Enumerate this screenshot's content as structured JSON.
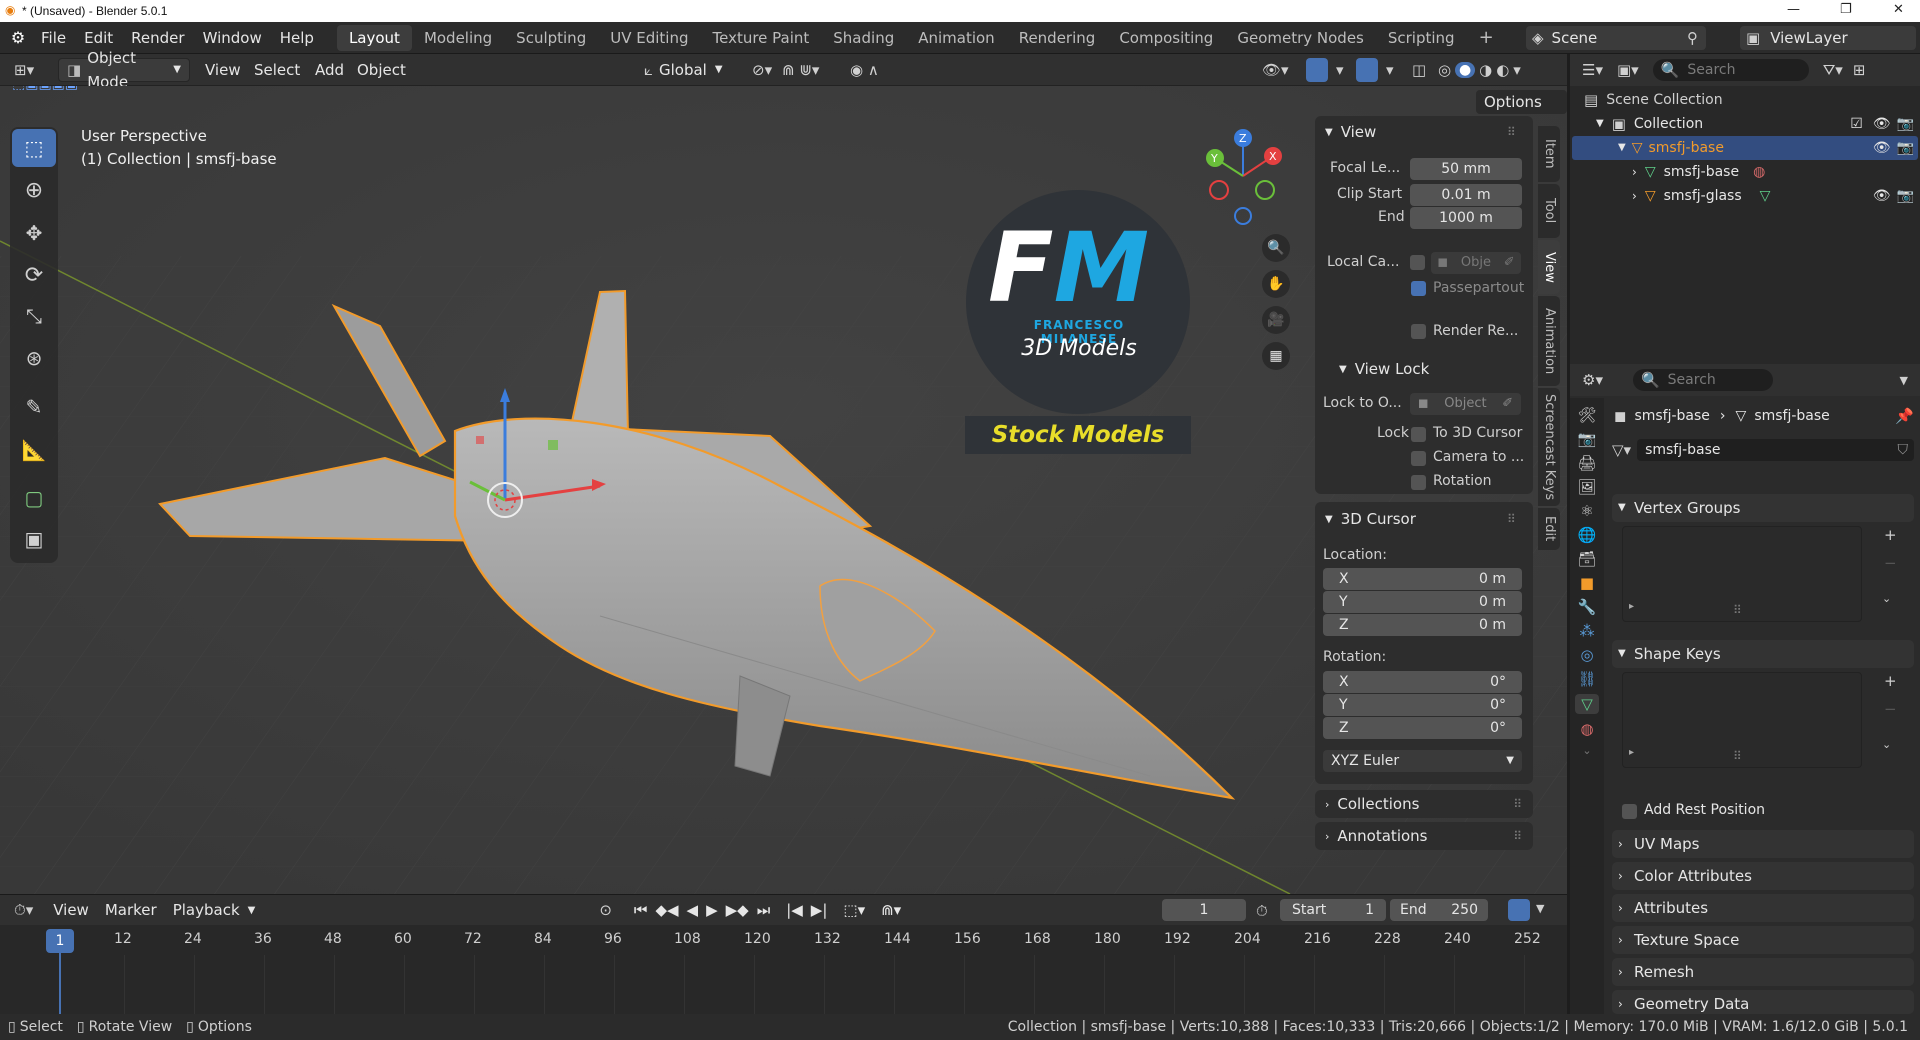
{
  "window": {
    "title": "* (Unsaved) - Blender 5.0.1"
  },
  "menu": {
    "items": [
      "File",
      "Edit",
      "Render",
      "Window",
      "Help"
    ]
  },
  "workspaces": [
    "Layout",
    "Modeling",
    "Sculpting",
    "UV Editing",
    "Texture Paint",
    "Shading",
    "Animation",
    "Rendering",
    "Compositing",
    "Geometry Nodes",
    "Scripting"
  ],
  "active_workspace": "Layout",
  "scene": {
    "label": "Scene",
    "view_layer": "ViewLayer"
  },
  "header": {
    "mode": "Object Mode",
    "items": [
      "View",
      "Select",
      "Add",
      "Object"
    ],
    "orientation": "Global",
    "options": "Options"
  },
  "viewport": {
    "perspective": "User Perspective",
    "context": "(1) Collection | smsfj-base"
  },
  "logo": {
    "initials_f": "F",
    "initials_m": "M",
    "name": "FRANCESCO MILANESE",
    "models": "3D Models",
    "stock": "Stock Models"
  },
  "npanel": {
    "tabs": [
      "Item",
      "Tool",
      "View",
      "Animation",
      "Screencast Keys",
      "Edit"
    ],
    "active_tab": "View",
    "view": {
      "title": "View",
      "focal_label": "Focal Le...",
      "focal_value": "50 mm",
      "clip_start_label": "Clip Start",
      "clip_start_value": "0.01 m",
      "end_label": "End",
      "end_value": "1000 m",
      "local_camera_label": "Local Ca...",
      "local_camera_value": "Obje",
      "passepartout": "Passepartout",
      "render_region": "Render Re..."
    },
    "view_lock": {
      "title": "View Lock",
      "lock_to_label": "Lock to O...",
      "lock_to_value": "Object",
      "lock_label": "Lock",
      "to_cursor": "To 3D Cursor",
      "camera_to": "Camera to ...",
      "rotation": "Rotation"
    },
    "cursor": {
      "title": "3D Cursor",
      "location_label": "Location:",
      "location": [
        {
          "axis": "X",
          "value": "0 m"
        },
        {
          "axis": "Y",
          "value": "0 m"
        },
        {
          "axis": "Z",
          "value": "0 m"
        }
      ],
      "rotation_label": "Rotation:",
      "rotation": [
        {
          "axis": "X",
          "value": "0°"
        },
        {
          "axis": "Y",
          "value": "0°"
        },
        {
          "axis": "Z",
          "value": "0°"
        }
      ],
      "rotation_mode": "XYZ Euler"
    },
    "collections": "Collections",
    "annotations": "Annotations"
  },
  "outliner": {
    "search_placeholder": "Search",
    "scene_collection": "Scene Collection",
    "collection": "Collection",
    "selected": "smsfj-base",
    "children": [
      "smsfj-base",
      "smsfj-glass"
    ]
  },
  "properties": {
    "search_placeholder": "Search",
    "breadcrumb_object": "smsfj-base",
    "breadcrumb_data": "smsfj-base",
    "mesh_name": "smsfj-base",
    "sections": [
      "Vertex Groups",
      "Shape Keys",
      "UV Maps",
      "Color Attributes",
      "Attributes",
      "Texture Space",
      "Remesh",
      "Geometry Data"
    ],
    "add_rest_position": "Add Rest Position"
  },
  "timeline": {
    "menu": [
      "View",
      "Marker",
      "Playback"
    ],
    "current_frame": "1",
    "start_label": "Start",
    "start": "1",
    "end_label": "End",
    "end": "250",
    "ticks": [
      "1",
      "12",
      "24",
      "36",
      "48",
      "60",
      "72",
      "84",
      "96",
      "108",
      "120",
      "132",
      "144",
      "156",
      "168",
      "180",
      "192",
      "204",
      "216",
      "228",
      "240",
      "252"
    ]
  },
  "status": {
    "select": "Select",
    "rotate": "Rotate View",
    "options": "Options",
    "info": "Collection | smsfj-base | Verts:10,388 | Faces:10,333 | Tris:20,666 | Objects:1/2 | Memory: 170.0 MiB | VRAM: 1.6/12.0 GiB | 5.0.1"
  },
  "colors": {
    "accent": "#4772b3",
    "selection": "#f29b2b",
    "logo_blue": "#1ea7e1",
    "stock_yellow": "#e8dd2a"
  }
}
